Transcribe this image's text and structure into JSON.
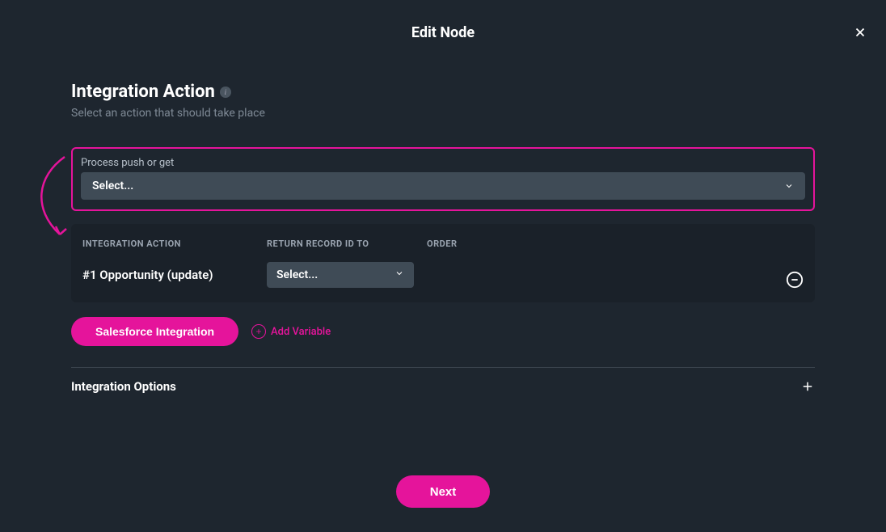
{
  "modal": {
    "title": "Edit Node",
    "close_label": "Close"
  },
  "section": {
    "title": "Integration Action",
    "subtitle": "Select an action that should take place"
  },
  "process": {
    "label": "Process push or get",
    "select_placeholder": "Select..."
  },
  "table": {
    "col_integration_action": "INTEGRATION ACTION",
    "col_return_record": "RETURN RECORD ID TO",
    "col_order": "ORDER",
    "rows": [
      {
        "action_label": "#1 Opportunity (update)",
        "return_select_placeholder": "Select..."
      }
    ]
  },
  "buttons": {
    "salesforce_integration": "Salesforce Integration",
    "add_variable": "Add Variable",
    "next": "Next"
  },
  "options": {
    "label": "Integration Options"
  },
  "colors": {
    "accent": "#e5149b",
    "bg": "#1e262f",
    "card": "#1a2129",
    "input": "#3f4b56"
  }
}
